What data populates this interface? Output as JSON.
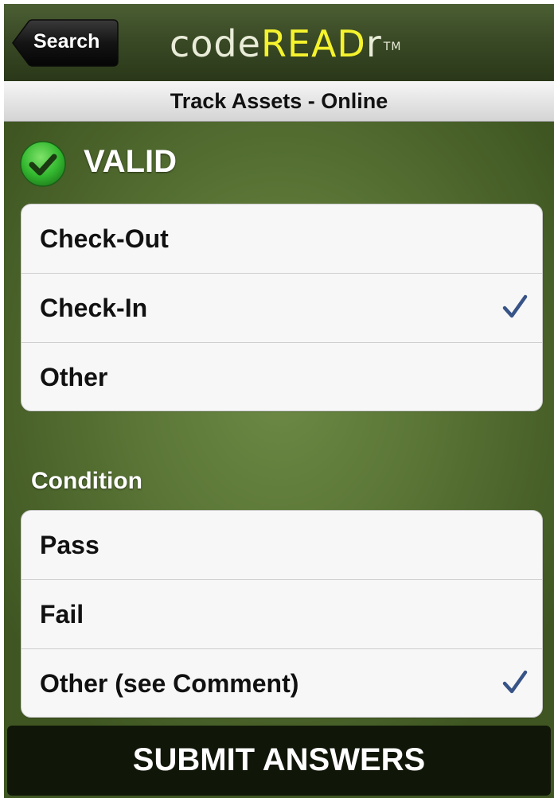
{
  "navbar": {
    "back_label": "Search",
    "logo_code": "code",
    "logo_read": "READ",
    "logo_r": "r",
    "logo_tm": "TM"
  },
  "subheader": {
    "title": "Track Assets - Online"
  },
  "status": {
    "label": "VALID",
    "icon": "green-check-circle-icon"
  },
  "action_group": {
    "items": [
      {
        "label": "Check-Out",
        "checked": false
      },
      {
        "label": "Check-In",
        "checked": true
      },
      {
        "label": "Other",
        "checked": false
      }
    ]
  },
  "condition_group": {
    "title": "Condition",
    "items": [
      {
        "label": "Pass",
        "checked": false
      },
      {
        "label": "Fail",
        "checked": false
      },
      {
        "label": "Other (see Comment)",
        "checked": true
      }
    ]
  },
  "submit": {
    "label": "SUBMIT ANSWERS"
  },
  "colors": {
    "background_green": "#5a7536",
    "checkmark_blue": "#385487",
    "logo_yellow": "#f5f32d",
    "valid_green": "#3cc23a"
  }
}
